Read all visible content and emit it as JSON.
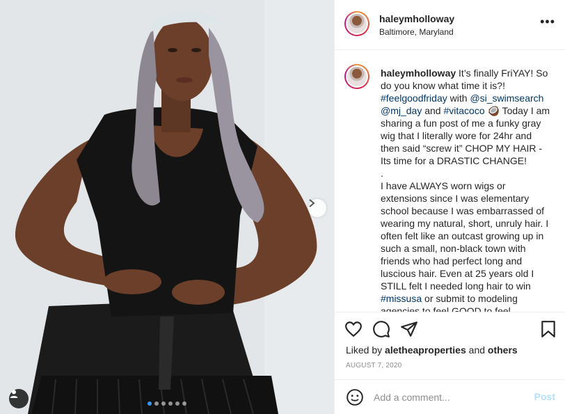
{
  "post": {
    "username": "haleymholloway",
    "location": "Baltimore, Maryland",
    "more_label": "•••",
    "caption": {
      "author": "haleymholloway",
      "line1_text": " It’s finally FriYAY! So do you know what time it is?! ",
      "tag1": "#feelgoodfriday",
      "with_text": " with ",
      "mention1": "@si_swimsearch",
      "space": " ",
      "mention2": "@mj_day",
      "and_text": " and ",
      "tag2": "#vitacoco",
      "emoji": "🥥",
      "line2_text": " Today I am sharing a fun post of me a funky gray wig that I literally wore for 24hr and then said “screw it” CHOP MY HAIR - Its time for a DRASTIC CHANGE!",
      "dot": ".",
      "para2_text": "I have ALWAYS worn wigs or extensions since I was elementary school because I was embarrassed of wearing my natural, short, unruly hair. I often felt like an outcast growing up in such a small, non-black town with friends who had perfect long and luscious hair. Even at 25 years old I STILL felt I needed long hair to win ",
      "tag3": "#missusa",
      "para2_tail": " or submit to modeling agencies to feel GOOD to feel"
    },
    "likes": {
      "prefix": "Liked by ",
      "user": "aletheaproperties",
      "and": " and ",
      "others": "others"
    },
    "date": "AUGUST 7, 2020",
    "comment": {
      "placeholder": "Add a comment...",
      "post_label": "Post"
    },
    "carousel": {
      "count": 6,
      "active_index": 0
    }
  },
  "icons": {
    "like": "heart-icon",
    "comment": "comment-icon",
    "share": "paper-plane-icon",
    "save": "bookmark-icon",
    "emoji": "smiley-icon",
    "next": "chevron-right-icon",
    "tag": "user-tag-icon"
  },
  "colors": {
    "link": "#00376b",
    "post_button": "#b2dffc",
    "muted": "#8e8e8e",
    "active_dot": "#3897f0"
  }
}
